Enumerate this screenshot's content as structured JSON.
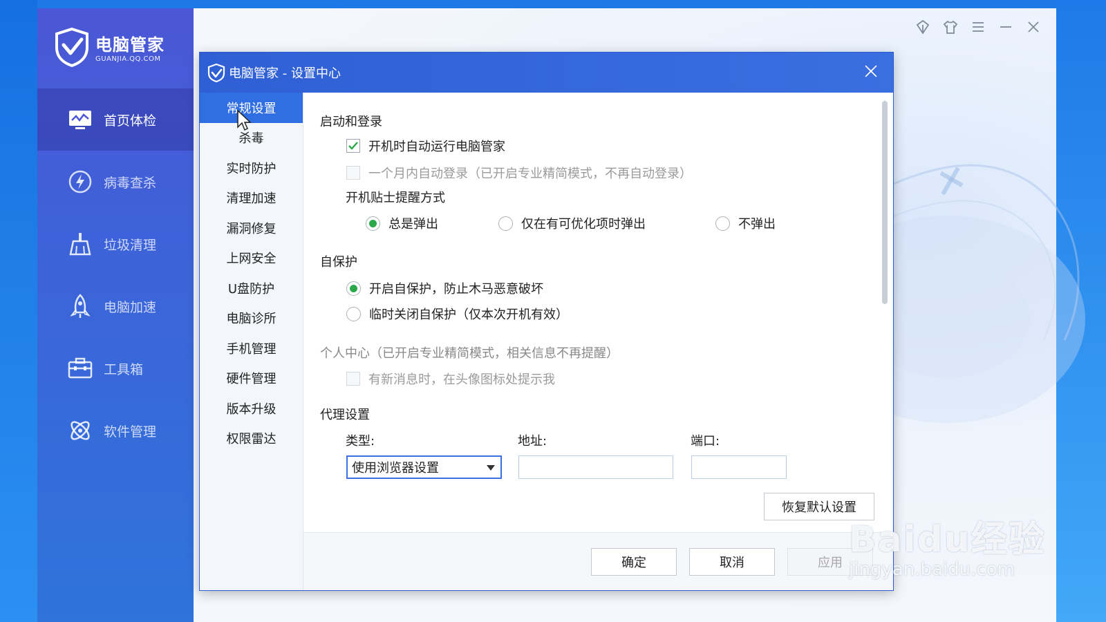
{
  "app": {
    "logo_title": "电脑管家",
    "logo_url": "GUANJIA.QQ.COM",
    "nav": [
      {
        "label": "首页体检",
        "icon": "monitor-chart-icon",
        "active": true
      },
      {
        "label": "病毒查杀",
        "icon": "lightning-shield-icon",
        "active": false
      },
      {
        "label": "垃圾清理",
        "icon": "broom-icon",
        "active": false
      },
      {
        "label": "电脑加速",
        "icon": "rocket-icon",
        "active": false
      },
      {
        "label": "工具箱",
        "icon": "toolbox-icon",
        "active": false
      },
      {
        "label": "软件管理",
        "icon": "apps-icon",
        "active": false
      }
    ],
    "window_controls": [
      "skin-icon",
      "shirt-icon",
      "menu-icon",
      "minimize-icon",
      "close-icon"
    ]
  },
  "dialog": {
    "title": "电脑管家 - 设置中心",
    "tabs": [
      "常规设置",
      "杀毒",
      "实时防护",
      "清理加速",
      "漏洞修复",
      "上网安全",
      "U盘防护",
      "电脑诊所",
      "手机管理",
      "硬件管理",
      "版本升级",
      "权限雷达"
    ],
    "active_tab": "常规设置",
    "startup": {
      "heading": "启动和登录",
      "auto_run_label": "开机时自动运行电脑管家",
      "auto_run_checked": true,
      "auto_login_label": "一个月内自动登录（已开启专业精简模式，不再自动登录）",
      "auto_login_checked": false,
      "tip_heading": "开机贴士提醒方式",
      "tip_options": [
        "总是弹出",
        "仅在有可优化项时弹出",
        "不弹出"
      ],
      "tip_selected": "总是弹出"
    },
    "self_protect": {
      "heading": "自保护",
      "options": [
        "开启自保护，防止木马恶意破坏",
        "临时关闭自保护（仅本次开机有效）"
      ],
      "selected": "开启自保护，防止木马恶意破坏"
    },
    "personal": {
      "heading": "个人中心（已开启专业精简模式，相关信息不再提醒）",
      "notify_label": "有新消息时，在头像图标处提示我",
      "notify_checked": false
    },
    "proxy": {
      "heading": "代理设置",
      "type_label": "类型:",
      "type_value": "使用浏览器设置",
      "address_label": "地址:",
      "address_value": "",
      "port_label": "端口:",
      "port_value": ""
    },
    "restore_button": "恢复默认设置",
    "ok_button": "确定",
    "cancel_button": "取消",
    "apply_button": "应用"
  },
  "watermark": {
    "brand": "Baidu经验",
    "url": "jingyan.baidu.com"
  },
  "colors": {
    "accent": "#2f6fe3",
    "sidebar_top": "#4b57d6",
    "radio_selected": "#2aa84a",
    "check_mark": "#2aa84a"
  }
}
